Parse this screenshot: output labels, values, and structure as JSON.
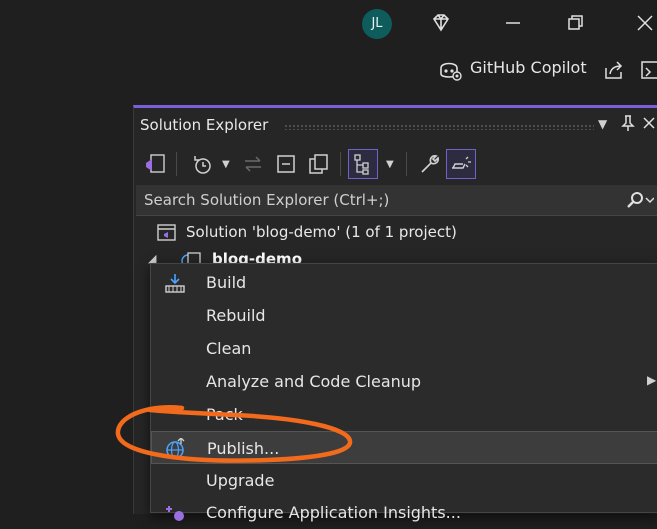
{
  "titlebar": {
    "avatar_initials": "JL"
  },
  "copilot": {
    "label": "GitHub Copilot"
  },
  "solution_explorer": {
    "title": "Solution Explorer",
    "search_placeholder": "Search Solution Explorer (Ctrl+;)",
    "solution_label": "Solution 'blog-demo' (1 of 1 project)",
    "project_label": "blog-demo"
  },
  "context_menu": {
    "items": [
      {
        "label": "Build"
      },
      {
        "label": "Rebuild"
      },
      {
        "label": "Clean"
      },
      {
        "label": "Analyze and Code Cleanup"
      },
      {
        "label": "Pack"
      },
      {
        "label": "Publish..."
      },
      {
        "label": "Upgrade"
      },
      {
        "label": "Configure Application Insights..."
      }
    ]
  },
  "colors": {
    "accent": "#7a5fd6",
    "annotation": "#f26a1b",
    "background": "#1f1f1f",
    "panel": "#262626",
    "menu": "#2b2b2b"
  }
}
